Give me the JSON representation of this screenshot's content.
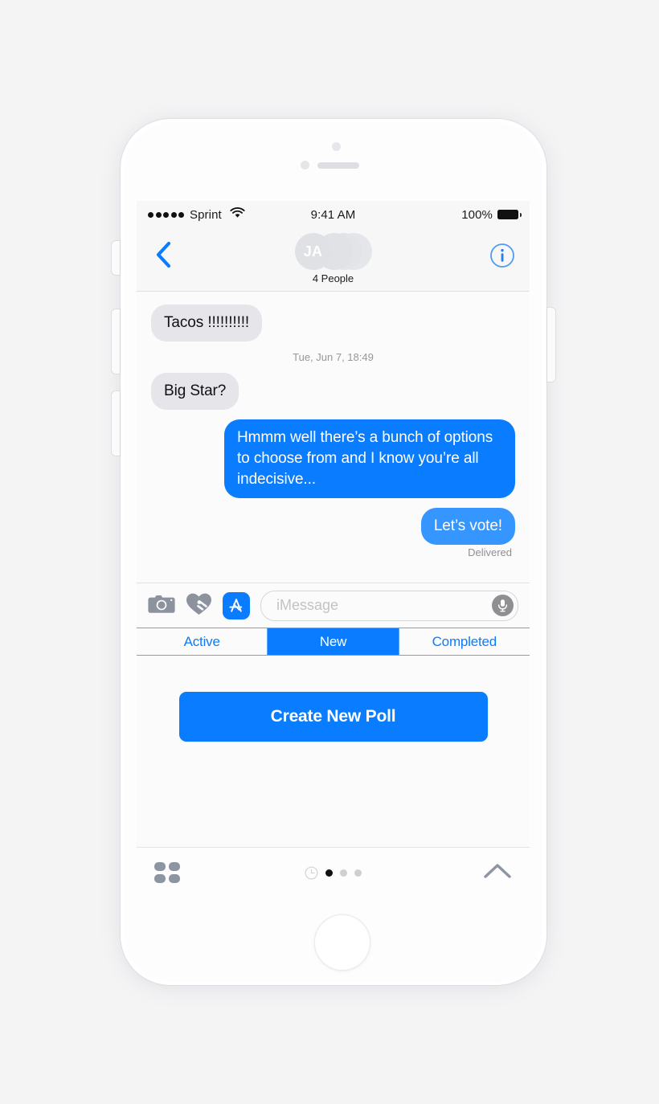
{
  "device": {
    "name": "iphone-7-silver",
    "frame_color": "#fdfdfd",
    "background_color": "#f4f4f5"
  },
  "status_bar": {
    "signal_dots": 5,
    "carrier": "Sprint",
    "wifi_icon": "wifi-icon",
    "time": "9:41 AM",
    "battery_percent": "100%",
    "battery_icon": "battery-full-icon"
  },
  "nav_bar": {
    "back_icon": "chevron-left-icon",
    "info_icon": "info-circle-icon",
    "avatar_initials": "JA",
    "avatar_stack_count": 4,
    "title": "4 People"
  },
  "conversation": {
    "messages": [
      {
        "id": "msg-1",
        "side": "left",
        "style": "grey",
        "text": "Tacos !!!!!!!!!!"
      },
      {
        "id": "msg-2",
        "side": "right",
        "style": "blue",
        "text": "Hmmm well there’s a bunch of options to choose from and I know you’re all indecisive..."
      },
      {
        "id": "msg-3",
        "side": "right",
        "style": "blue-light",
        "text": "Let’s vote!"
      }
    ],
    "timestamp": "Tue, Jun 7, 18:49",
    "delivered_label": "Delivered",
    "bubble_colors": {
      "incoming": "#e5e5ea",
      "outgoing": "#0a7cff",
      "outgoing_light": "#3596ff"
    }
  },
  "input_bar": {
    "camera_icon": "camera-icon",
    "digital_touch_icon": "heart-hand-icon",
    "app_store_icon": "app-store-icon",
    "placeholder": "iMessage",
    "value": "",
    "mic_icon": "microphone-icon"
  },
  "segmented_control": {
    "options": [
      "Active",
      "New",
      "Completed"
    ],
    "selected_index": 1,
    "accent_color": "#0a7cff"
  },
  "app_panel": {
    "primary_button": "Create New Poll",
    "primary_button_color": "#0a7cff"
  },
  "bottom_bar": {
    "grid_icon": "app-grid-icon",
    "recents_icon": "recents-clock-icon",
    "page_dots": 3,
    "active_dot_index": 0,
    "expand_icon": "chevron-up-icon"
  }
}
